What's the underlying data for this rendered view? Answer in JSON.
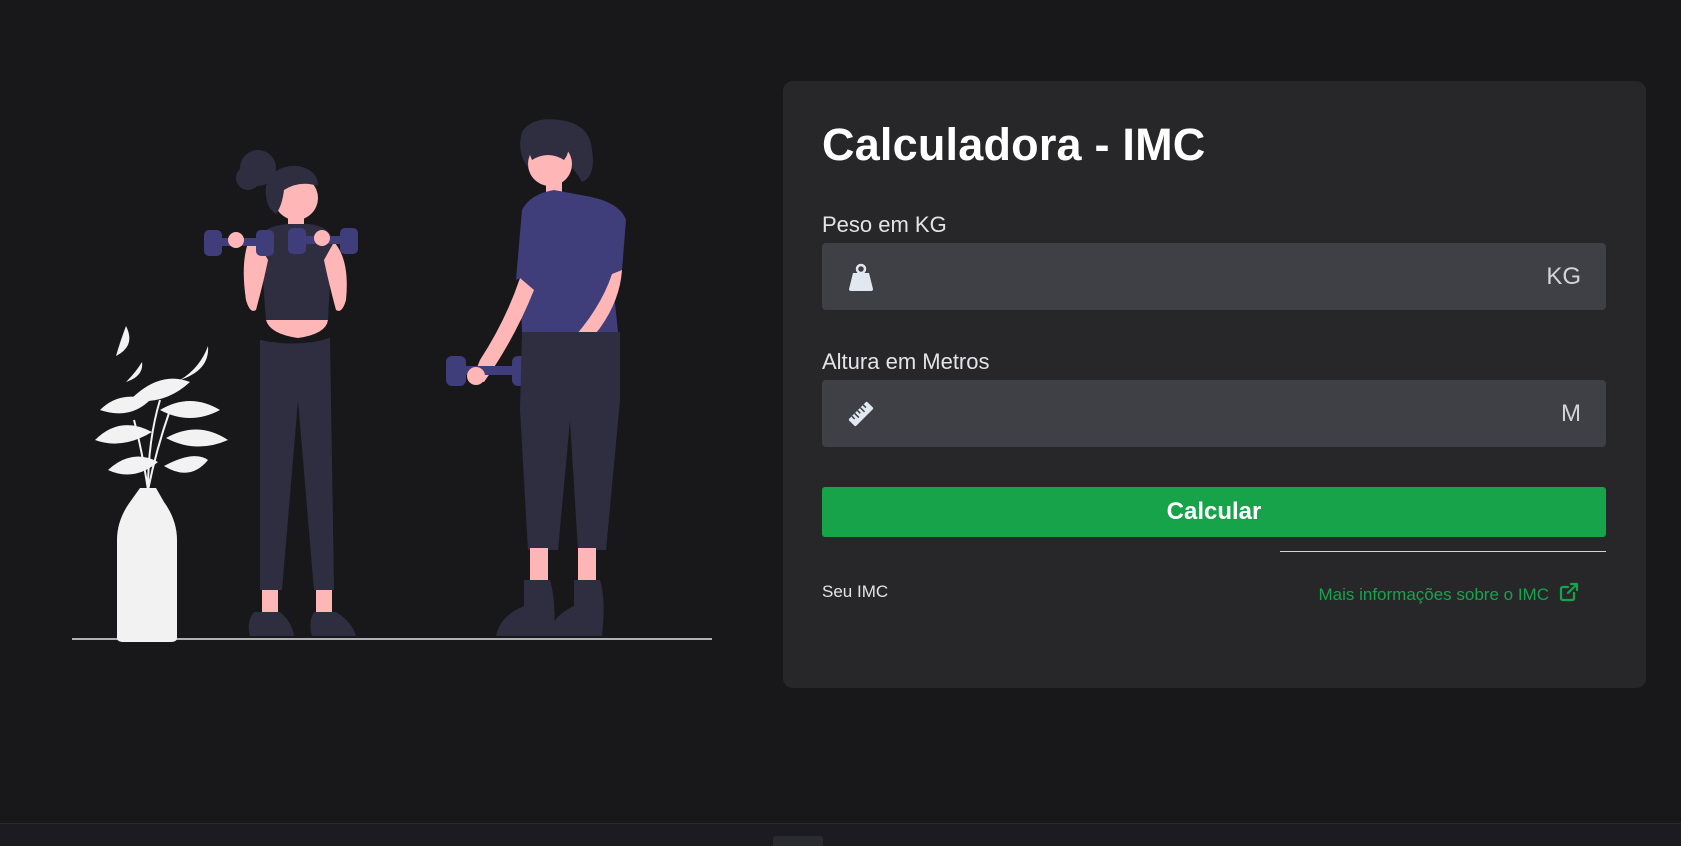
{
  "page": {
    "background": "#18181b"
  },
  "card": {
    "title": "Calculadora - IMC",
    "weight": {
      "label": "Peso em KG",
      "value": "",
      "placeholder": "",
      "unit": "KG",
      "icon": "weight-icon"
    },
    "height": {
      "label": "Altura em Metros",
      "value": "",
      "placeholder": "",
      "unit": "M",
      "icon": "ruler-icon"
    },
    "calculate_label": "Calcular",
    "result_label": "Seu IMC",
    "info_link_label": "Mais informações sobre o IMC",
    "info_link_icon": "external-link-icon"
  },
  "colors": {
    "accent": "#16a34a",
    "card": "#27272a",
    "input": "#3f3f46",
    "illustration_primary": "#3f3d7a",
    "illustration_dark": "#2f2e41",
    "skin": "#ffb6b6",
    "plant": "#f2f2f2"
  }
}
